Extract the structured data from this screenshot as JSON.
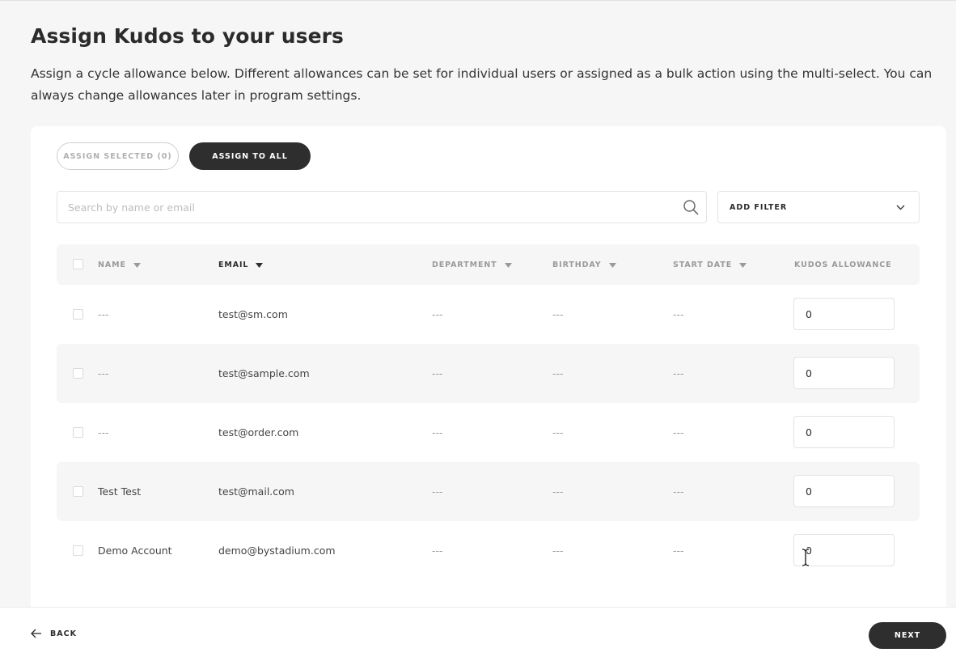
{
  "page": {
    "title": "Assign Kudos to your users",
    "description": "Assign a cycle allowance below. Different allowances can be set for individual users or assigned as a bulk action using the multi-select. You can always change allowances later in program settings."
  },
  "actions": {
    "assign_selected": "ASSIGN SELECTED (0)",
    "assign_all": "ASSIGN TO ALL"
  },
  "search": {
    "placeholder": "Search by name or email",
    "value": ""
  },
  "filter": {
    "label": "ADD FILTER"
  },
  "table": {
    "columns": {
      "name": "NAME",
      "email": "EMAIL",
      "department": "DEPARTMENT",
      "birthday": "BIRTHDAY",
      "start_date": "START DATE",
      "allowance": "KUDOS ALLOWANCE"
    },
    "rows": [
      {
        "name": "---",
        "email": "test@sm.com",
        "department": "---",
        "birthday": "---",
        "start_date": "---",
        "allowance": "0"
      },
      {
        "name": "---",
        "email": "test@sample.com",
        "department": "---",
        "birthday": "---",
        "start_date": "---",
        "allowance": "0"
      },
      {
        "name": "---",
        "email": "test@order.com",
        "department": "---",
        "birthday": "---",
        "start_date": "---",
        "allowance": "0"
      },
      {
        "name": "Test Test",
        "email": "test@mail.com",
        "department": "---",
        "birthday": "---",
        "start_date": "---",
        "allowance": "0"
      },
      {
        "name": "Demo Account",
        "email": "demo@bystadium.com",
        "department": "---",
        "birthday": "---",
        "start_date": "---",
        "allowance": "0"
      }
    ]
  },
  "footer": {
    "back": "BACK",
    "next": "NEXT"
  },
  "icons": {
    "search": "search-icon",
    "filter_chevron": "chevron-down-icon",
    "sort": "sort-caret-icon",
    "back": "arrow-left-icon",
    "cursor": "text-cursor-icon"
  },
  "colors": {
    "page_bg": "#f6f6f6",
    "primary_button": "#2e2e2e",
    "text": "#2b2b2b",
    "muted": "#9a9a9a"
  }
}
